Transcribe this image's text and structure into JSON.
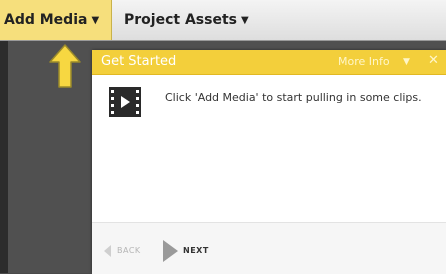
{
  "menubar": {
    "add_media_label": "Add Media",
    "project_assets_label": "Project Assets",
    "caret": "▼"
  },
  "popup": {
    "title": "Get Started",
    "more_info_label": "More Info",
    "more_info_caret": "▼",
    "close_glyph": "✕",
    "message": "Click 'Add Media' to start pulling in some clips.",
    "back_label": "BACK",
    "next_label": "NEXT"
  },
  "colors": {
    "accent_yellow": "#f3cf3b",
    "menu_highlight": "#f6df7c",
    "backdrop": "#505050"
  },
  "icons": {
    "pointer_arrow": "up-arrow-icon",
    "media": "film-icon",
    "back": "back-arrow-icon",
    "next": "next-arrow-icon"
  }
}
